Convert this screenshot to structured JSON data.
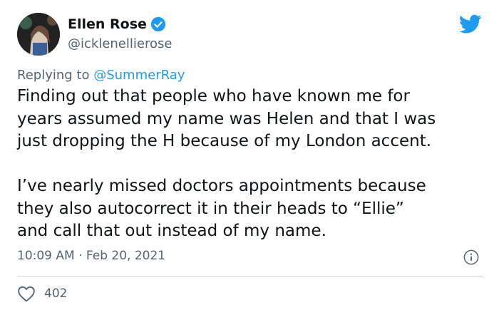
{
  "tweet": {
    "author": {
      "display_name": "Ellen Rose",
      "handle": "@icklenellierose",
      "verified": true,
      "avatar_icon": "profile-photo"
    },
    "brand_icon": "twitter-bird-icon",
    "replying_to": {
      "prefix": "Replying to",
      "handle": "@SummerRay"
    },
    "paragraph_1_lines": [
      "Finding out that people who have known me for",
      "years assumed my name was Helen and that I was",
      "just dropping the H because of my London accent."
    ],
    "paragraph_2_lines": [
      "I’ve nearly missed doctors appointments because",
      "they also autocorrect it in their heads to “Ellie”",
      "and call that out instead of my name."
    ],
    "time": "10:09 AM",
    "separator": "·",
    "date": "Feb 20, 2021",
    "like_count": "402"
  },
  "colors": {
    "accent": "#1d9bf0",
    "text": "#0f1419",
    "secondary": "#536471",
    "divider": "#cfd9de"
  }
}
